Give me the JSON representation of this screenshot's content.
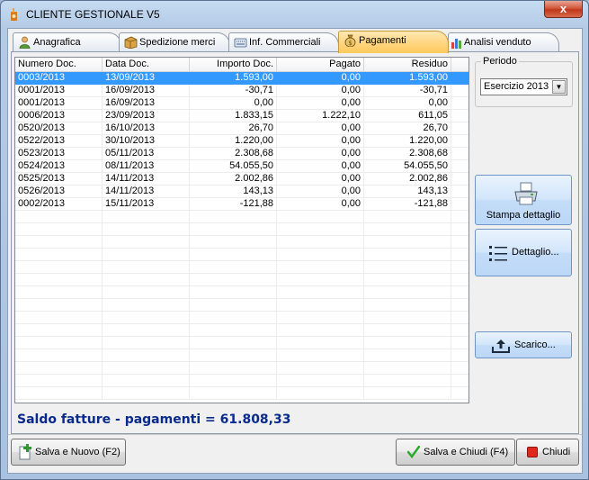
{
  "window": {
    "title": "CLIENTE GESTIONALE V5",
    "close_glyph": "x"
  },
  "tabs": [
    {
      "label": "Anagrafica",
      "icon": "person-icon",
      "active": false
    },
    {
      "label": "Spedizione merci",
      "icon": "box-icon",
      "active": false
    },
    {
      "label": "Inf. Commerciali",
      "icon": "keyboard-icon",
      "active": false
    },
    {
      "label": "Pagamenti",
      "icon": "money-bag-icon",
      "active": true
    },
    {
      "label": "Analisi venduto",
      "icon": "bar-chart-icon",
      "active": false
    }
  ],
  "grid": {
    "columns": [
      "Numero Doc.",
      "Data Doc.",
      "Importo Doc.",
      "Pagato",
      "Residuo"
    ],
    "rows": [
      [
        "0003/2013",
        "13/09/2013",
        "1.593,00",
        "0,00",
        "1.593,00"
      ],
      [
        "0001/2013",
        "16/09/2013",
        "-30,71",
        "0,00",
        "-30,71"
      ],
      [
        "0001/2013",
        "16/09/2013",
        "0,00",
        "0,00",
        "0,00"
      ],
      [
        "0006/2013",
        "23/09/2013",
        "1.833,15",
        "1.222,10",
        "611,05"
      ],
      [
        "0520/2013",
        "16/10/2013",
        "26,70",
        "0,00",
        "26,70"
      ],
      [
        "0522/2013",
        "30/10/2013",
        "1.220,00",
        "0,00",
        "1.220,00"
      ],
      [
        "0523/2013",
        "05/11/2013",
        "2.308,68",
        "0,00",
        "2.308,68"
      ],
      [
        "0524/2013",
        "08/11/2013",
        "54.055,50",
        "0,00",
        "54.055,50"
      ],
      [
        "0525/2013",
        "14/11/2013",
        "2.002,86",
        "0,00",
        "2.002,86"
      ],
      [
        "0526/2013",
        "14/11/2013",
        "143,13",
        "0,00",
        "143,13"
      ],
      [
        "0002/2013",
        "15/11/2013",
        "-121,88",
        "0,00",
        "-121,88"
      ]
    ],
    "selected_row": 0
  },
  "periodo": {
    "legend": "Periodo",
    "selected": "Esercizio 2013"
  },
  "buttons": {
    "stampa": "Stampa dettaglio",
    "dettaglio": "Dettaglio...",
    "scarico": "Scarico...",
    "salva_nuovo": "Salva e Nuovo (F2)",
    "salva_chiudi": "Salva e Chiudi (F4)",
    "chiudi": "Chiudi"
  },
  "saldo": "Saldo fatture - pagamenti = 61.808,33",
  "colors": {
    "selection": "#3399ff",
    "active_tab": "#ffd37c",
    "saldo_text": "#0a2a8c"
  }
}
